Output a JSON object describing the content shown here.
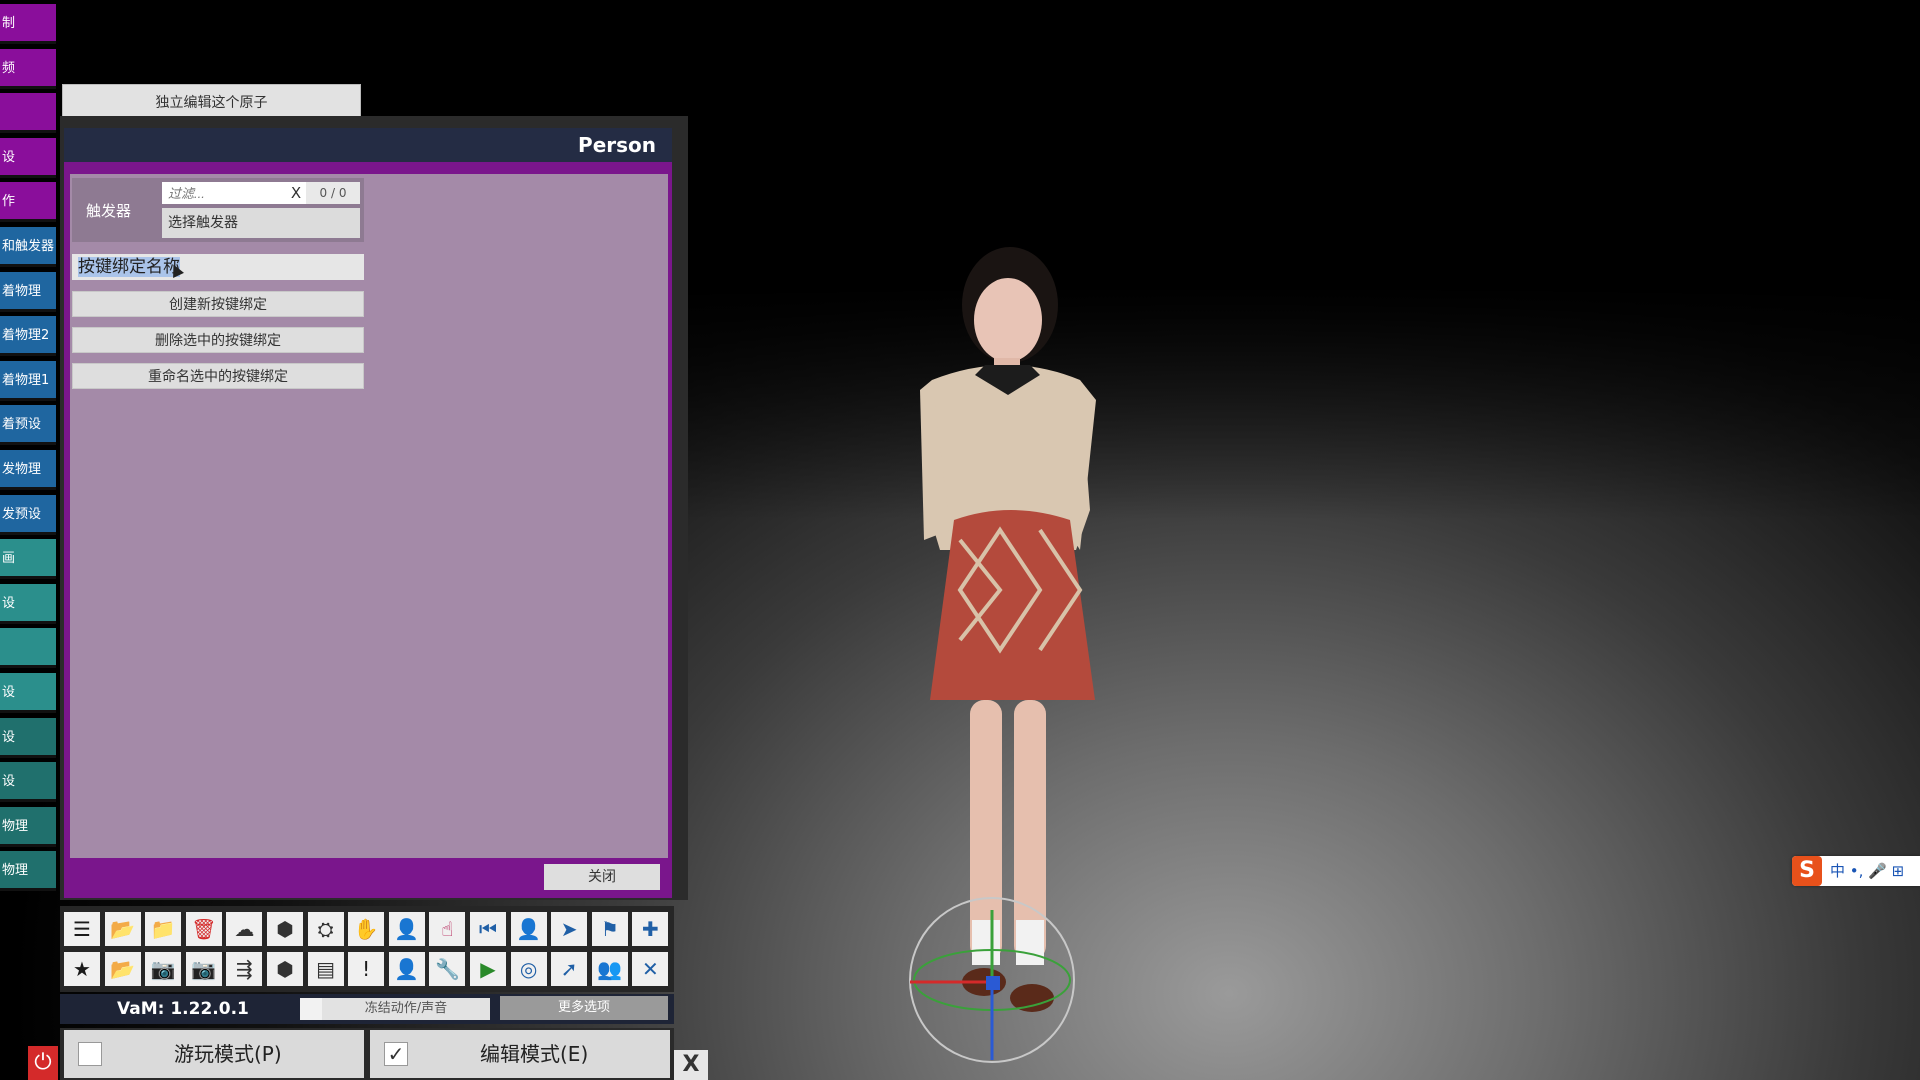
{
  "left_tabs": [
    {
      "label": "制",
      "color": "purple"
    },
    {
      "label": "频",
      "color": "purple"
    },
    {
      "label": "",
      "color": "purple"
    },
    {
      "label": "设",
      "color": "purple"
    },
    {
      "label": "作",
      "color": "purple"
    },
    {
      "label": "和触发器",
      "color": "blue"
    },
    {
      "label": "着物理",
      "color": "blue"
    },
    {
      "label": "着物理2",
      "color": "blue"
    },
    {
      "label": "着物理1",
      "color": "blue"
    },
    {
      "label": "着预设",
      "color": "blue"
    },
    {
      "label": "发物理",
      "color": "blue"
    },
    {
      "label": "发预设",
      "color": "blue"
    },
    {
      "label": "画",
      "color": "teal"
    },
    {
      "label": "设",
      "color": "teal"
    },
    {
      "label": "",
      "color": "teal"
    },
    {
      "label": "设",
      "color": "teal"
    },
    {
      "label": "设",
      "color": "dteal"
    },
    {
      "label": "设",
      "color": "dteal"
    },
    {
      "label": "物理",
      "color": "dteal"
    },
    {
      "label": "物理",
      "color": "dteal"
    }
  ],
  "edit_atom_button": "独立编辑这个原子",
  "panel": {
    "title": "Person",
    "trigger_label": "触发器",
    "filter_placeholder": "过滤...",
    "filter_clear": "X",
    "filter_count": "0 / 0",
    "select_trigger": "选择触发器",
    "binding_name_value": "按键绑定名称",
    "buttons": {
      "create": "创建新按键绑定",
      "delete": "删除选中的按键绑定",
      "rename": "重命名选中的按键绑定"
    },
    "close": "关闭"
  },
  "toolbar": {
    "row1": [
      {
        "icon": "menu-icon",
        "glyph": "☰",
        "color": "#1a1a1a"
      },
      {
        "icon": "open-folder-icon",
        "glyph": "📂",
        "color": "#2aa52a"
      },
      {
        "icon": "folder-icon",
        "glyph": "📁",
        "color": "#2aa52a"
      },
      {
        "icon": "delete-icon",
        "glyph": "🗑",
        "color": "#d42a2a"
      },
      {
        "icon": "cloud-upload-icon",
        "glyph": "☁",
        "color": "#333"
      },
      {
        "icon": "cube-icon",
        "glyph": "⬢",
        "color": "#333"
      },
      {
        "icon": "hub-icon",
        "glyph": "⛭",
        "color": "#333"
      },
      {
        "icon": "hand-icon",
        "glyph": "✋",
        "color": "#b0124c"
      },
      {
        "icon": "person-gear-icon",
        "glyph": "👤",
        "color": "#b0124c"
      },
      {
        "icon": "pointer-hand-icon",
        "glyph": "☝",
        "color": "#b0124c"
      },
      {
        "icon": "skip-back-icon",
        "glyph": "⏮",
        "color": "#1f5fa6"
      },
      {
        "icon": "person-icon",
        "glyph": "👤",
        "color": "#1f5fa6"
      },
      {
        "icon": "send-icon",
        "glyph": "➤",
        "color": "#1f5fa6"
      },
      {
        "icon": "flag-icon",
        "glyph": "⚑",
        "color": "#1f5fa6"
      },
      {
        "icon": "plus-icon",
        "glyph": "✚",
        "color": "#1f5fa6"
      }
    ],
    "row2": [
      {
        "icon": "star-icon",
        "glyph": "★",
        "color": "#1a1a1a"
      },
      {
        "icon": "open-file-icon",
        "glyph": "📂",
        "color": "#c9a12a"
      },
      {
        "icon": "camera-folder-icon",
        "glyph": "📷",
        "color": "#2aa52a"
      },
      {
        "icon": "camera-icon",
        "glyph": "📷",
        "color": "#333"
      },
      {
        "icon": "share-icon",
        "glyph": "⇶",
        "color": "#333"
      },
      {
        "icon": "package-icon",
        "glyph": "⬢",
        "color": "#333"
      },
      {
        "icon": "document-icon",
        "glyph": "▤",
        "color": "#333"
      },
      {
        "icon": "alert-icon",
        "glyph": "!",
        "color": "#1a1a1a"
      },
      {
        "icon": "person-settings-icon",
        "glyph": "👤",
        "color": "#b0124c"
      },
      {
        "icon": "wrench-icon",
        "glyph": "🔧",
        "color": "#b0124c"
      },
      {
        "icon": "play-icon",
        "glyph": "▶",
        "color": "#2a8a2a"
      },
      {
        "icon": "target-icon",
        "glyph": "◎",
        "color": "#1f5fa6"
      },
      {
        "icon": "cursor-icon",
        "glyph": "➚",
        "color": "#1f5fa6"
      },
      {
        "icon": "people-icon",
        "glyph": "👥",
        "color": "#1f5fa6"
      },
      {
        "icon": "tools-icon",
        "glyph": "✕",
        "color": "#1f5fa6"
      }
    ]
  },
  "status_bar": {
    "version": "VaM: 1.22.0.1",
    "freeze": "冻结动作/声音",
    "more": "更多选项"
  },
  "modes": {
    "play": "游玩模式(P)",
    "edit": "编辑模式(E)",
    "edit_check": "✓"
  },
  "power_glyph": "⏻",
  "close_x": "X",
  "ime": {
    "logo": "S",
    "text": "中 •, 🎤 ⊞"
  }
}
